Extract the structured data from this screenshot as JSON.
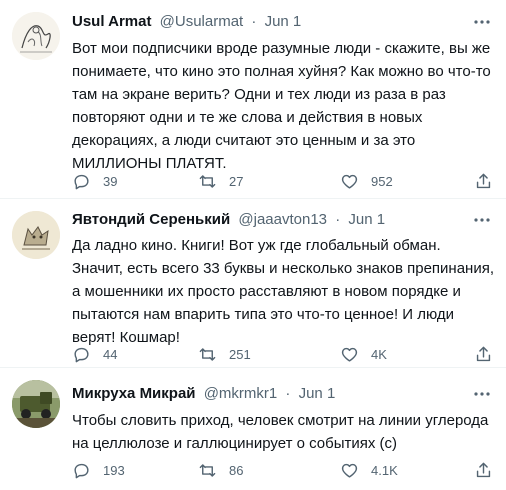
{
  "colors": {
    "text": "#0f1419",
    "secondary": "#536471",
    "divider": "#eff3f4"
  },
  "tweets": [
    {
      "name": "Usul Armat",
      "handle": "@Usularmat",
      "sep": "·",
      "date": "Jun 1",
      "text": "Вот мои подписчики вроде разумные люди - скажите, вы же\nпонимаете, что кино это полная хуйня? Как можно во что-то\nтам на экране верить? Одни и тех люди из раза в раз\nповторяют одни и те же слова и действия в новых\nдекорациях, а люди считают это ценным и за это\nМИЛЛИОНЫ ПЛАТЯТ.",
      "replies": "39",
      "retweets": "27",
      "likes": "952",
      "avatar_icon": "sketch-drawing-avatar"
    },
    {
      "name": "Явтондий Серенький",
      "handle": "@jaaavton13",
      "sep": "·",
      "date": "Jun 1",
      "text": "Да ладно кино. Книги! Вот уж где глобальный обман.\nЗначит, есть всего 33 буквы и несколько знаков препинания,\nа мошенники их просто расставляют в новом порядке и\nпытаются нам впарить типа это что-то ценное! И люди\nверят! Кошмар!",
      "replies": "44",
      "retweets": "251",
      "likes": "4K",
      "avatar_icon": "wolf-drawing-avatar"
    },
    {
      "name": "Микруха Микрай",
      "handle": "@mkrmkr1",
      "sep": "·",
      "date": "Jun 1",
      "text": "Чтобы словить приход, человек смотрит на линии углерода\nна целлюлозе и галлюцинирует о событиях (с)",
      "replies": "193",
      "retweets": "86",
      "likes": "4.1K",
      "avatar_icon": "truck-photo-avatar"
    }
  ]
}
